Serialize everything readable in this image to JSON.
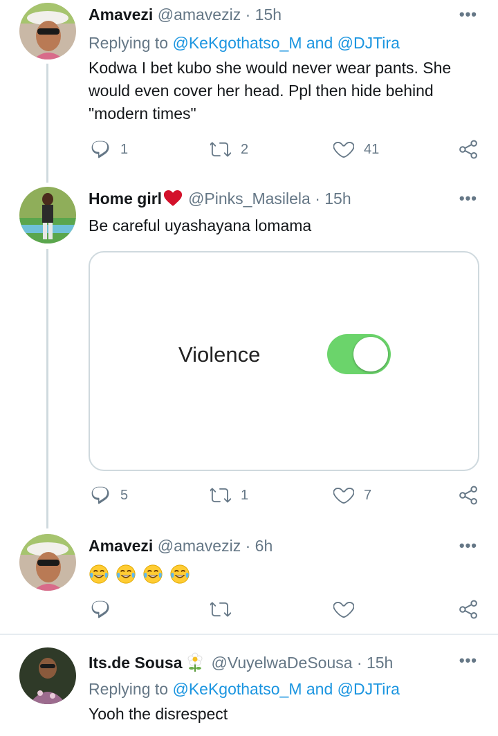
{
  "tweets": [
    {
      "name": "Amavezi",
      "meta": "@amaveziz · 15h",
      "reply_prefix": "Replying to",
      "reply_handle_1": "@KeKgothatso_M",
      "reply_and": "and",
      "reply_handle_2": "@DJTira",
      "text": "Kodwa I bet kubo she would never wear pants. She would even cover her head. Ppl then hide behind \"modern times\"",
      "replies": "1",
      "retweets": "2",
      "likes": "41"
    },
    {
      "name": "Home girl",
      "meta": "@Pinks_Masilela · 15h",
      "text": "Be careful uyashayana lomama",
      "media_label": "Violence",
      "media_toggle_on": true,
      "replies": "5",
      "retweets": "1",
      "likes": "7"
    },
    {
      "name": "Amavezi",
      "meta": "@amaveziz · 6h",
      "emoji_count": 4,
      "emoji_icon": "face-with-tears-of-joy-emoji"
    },
    {
      "name": "Its.de Sousa",
      "meta": "@VuyelwaDeSousa · 15h",
      "reply_prefix": "Replying to",
      "reply_handle_1": "@KeKgothatso_M",
      "reply_and": "and",
      "reply_handle_2": "@DJTira",
      "text": "Yooh the disrespect"
    }
  ],
  "icons": {
    "more": "more-dots-icon",
    "reply": "reply-bubble-icon",
    "retweet": "retweet-icon",
    "like": "heart-icon",
    "share": "share-icon",
    "name_heart": "red-heart-emoji",
    "name_flower": "flower-emoji"
  },
  "colors": {
    "link": "#1b95e0",
    "secondary": "#657786",
    "thread_line": "#cfd9de",
    "toggle_on": "#6bd46b",
    "heart_emoji": "#d3112b"
  }
}
